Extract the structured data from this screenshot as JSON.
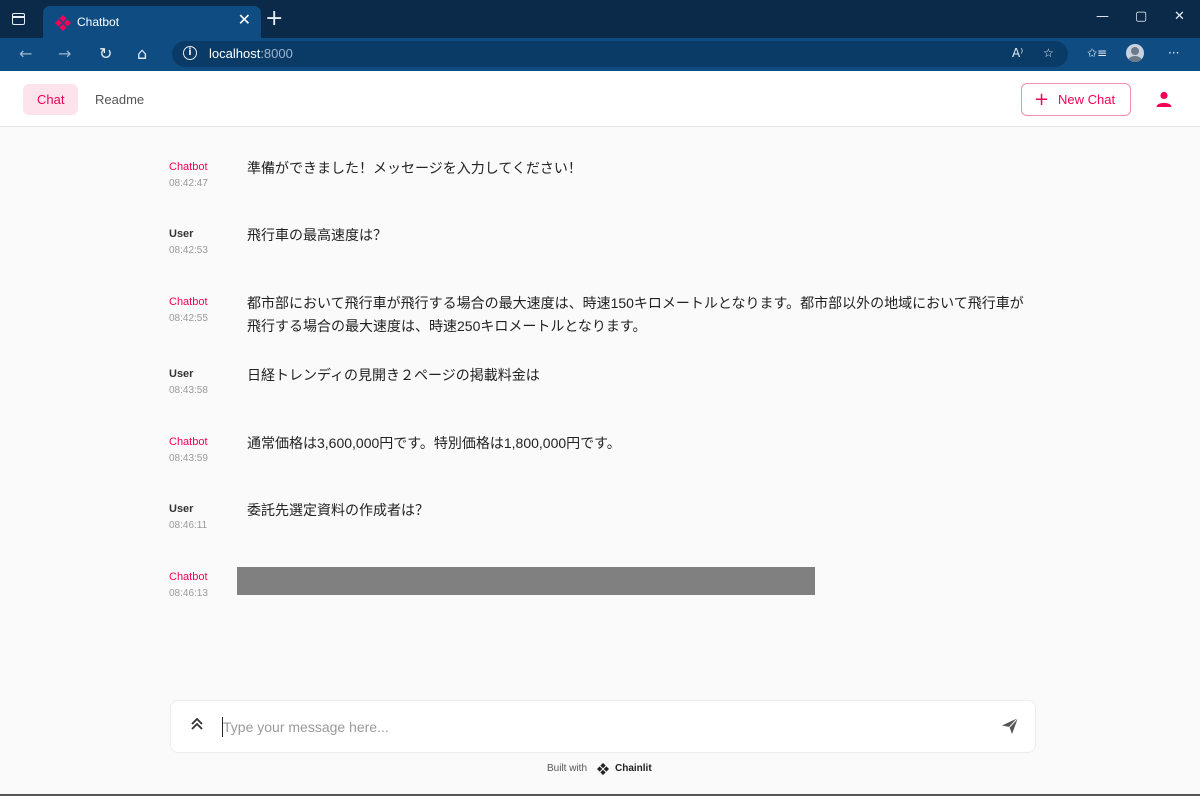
{
  "browser": {
    "tab_title": "Chatbot",
    "tab_close": "✕",
    "new_tab": "+",
    "url_host": "localhost",
    "url_port": ":8000",
    "read_aloud": "A⁾",
    "more": "···"
  },
  "app": {
    "tabs": [
      "Chat",
      "Readme"
    ],
    "new_chat_label": "New Chat",
    "accent_color": "#f50057"
  },
  "messages": [
    {
      "author": "Chatbot",
      "time": "08:42:47",
      "text": "準備ができました！メッセージを入力してください！"
    },
    {
      "author": "User",
      "time": "08:42:53",
      "text": "飛行車の最高速度は？"
    },
    {
      "author": "Chatbot",
      "time": "08:42:55",
      "text": "都市部において飛行車が飛行する場合の最大速度は、時速150キロメートルとなります。都市部以外の地域において飛行車が飛行する場合の最大速度は、時速250キロメートルとなります。"
    },
    {
      "author": "User",
      "time": "08:43:58",
      "text": "日経トレンディの見開き２ページの掲載料金は"
    },
    {
      "author": "Chatbot",
      "time": "08:43:59",
      "text": "通常価格は3,600,000円です。特別価格は1,800,000円です。"
    },
    {
      "author": "User",
      "time": "08:46:11",
      "text": "委託先選定資料の作成者は？"
    },
    {
      "author": "Chatbot",
      "time": "08:46:13",
      "text": ""
    }
  ],
  "composer": {
    "placeholder": "Type your message here..."
  },
  "footer": {
    "built_with": "Built with",
    "brand": "Chainlit"
  }
}
